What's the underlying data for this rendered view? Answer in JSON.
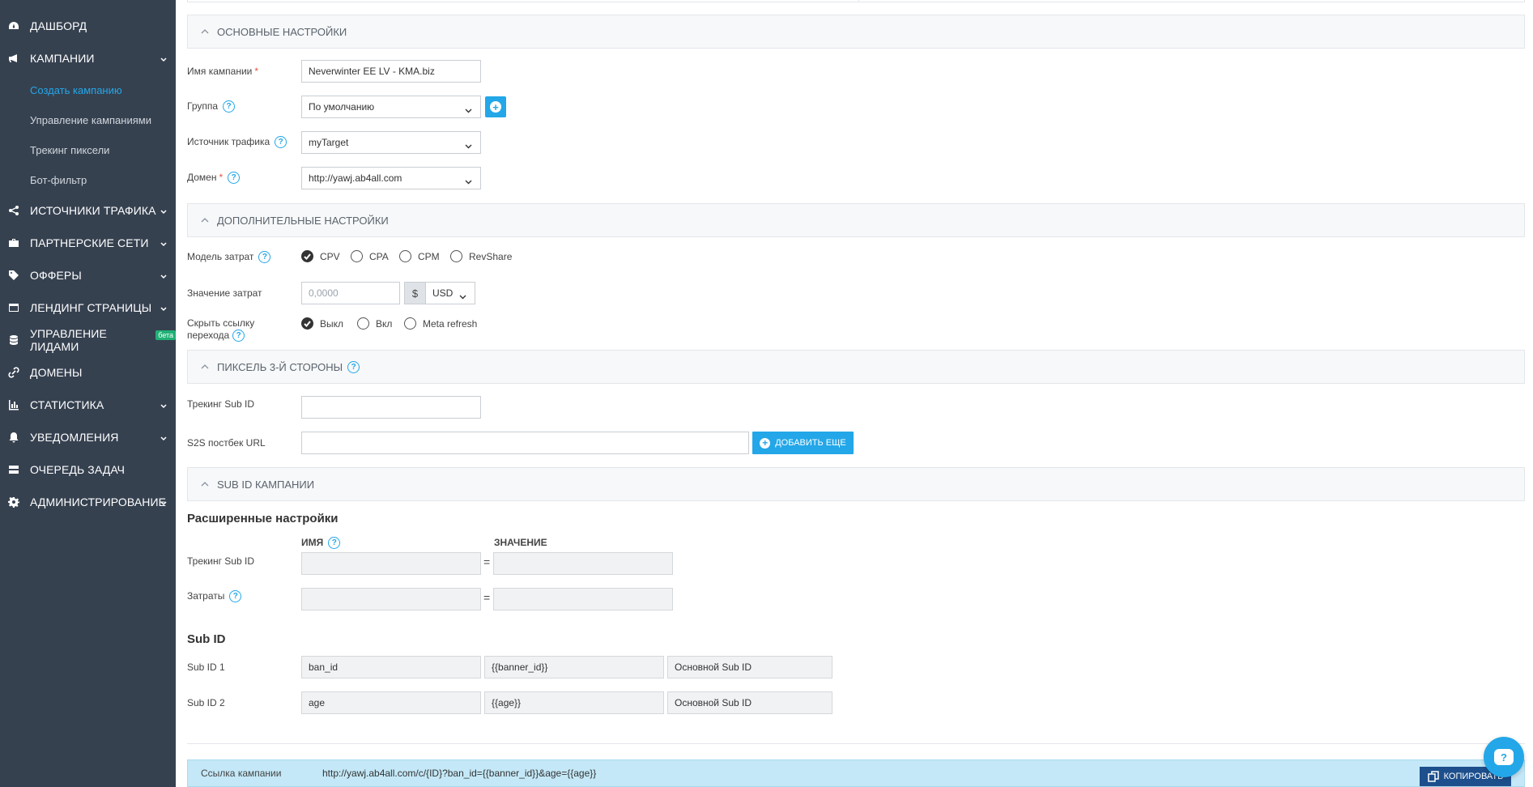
{
  "sidebar": {
    "items": [
      {
        "label": "Дашборд",
        "icon": "dashboard-icon"
      },
      {
        "label": "Кампании",
        "icon": "megaphone-icon"
      },
      {
        "label": "Источники трафика",
        "icon": "share-icon"
      },
      {
        "label": "Партнерские сети",
        "icon": "briefcase-icon"
      },
      {
        "label": "Офферы",
        "icon": "tags-icon"
      },
      {
        "label": "Лендинг страницы",
        "icon": "page-icon"
      },
      {
        "label": "Управление лидами",
        "icon": "database-icon",
        "badge": "бета"
      },
      {
        "label": "Домены",
        "icon": "link-icon"
      },
      {
        "label": "Статистика",
        "icon": "bar-chart-icon"
      },
      {
        "label": "Уведомления",
        "icon": "bell-icon"
      },
      {
        "label": "Очередь задач",
        "icon": "server-icon"
      },
      {
        "label": "Администрирование",
        "icon": "gear-icon"
      }
    ],
    "sub_items": [
      "Создать кампанию",
      "Управление кампаниями",
      "Трекинг пиксели",
      "Бот-фильтр"
    ]
  },
  "sections": {
    "basic": "Основные настройки",
    "additional": "Дополнительные настройки",
    "pixel": "Пиксель 3-й стороны",
    "subid": "Sub ID кампании"
  },
  "basic": {
    "name_label": "Имя кампании",
    "name_value": "Neverwinter EE LV - KMA.biz",
    "group_label": "Группа",
    "group_value": "По умолчанию",
    "source_label": "Источник трафика",
    "source_value": "myTarget",
    "domain_label": "Домен",
    "domain_value": "http://yawj.ab4all.com",
    "required_mark": "*"
  },
  "additional": {
    "cost_model_label": "Модель затрат",
    "cost_models": [
      "CPV",
      "CPA",
      "CPM",
      "RevShare"
    ],
    "cost_value_label": "Значение затрат",
    "cost_value_placeholder": "0,0000",
    "currency_symbol": "$",
    "currency": "USD",
    "hide_link_label_1": "Скрыть ссылку",
    "hide_link_label_2": "перехода",
    "hide_options": [
      "Выкл",
      "Вкл",
      "Meta refresh"
    ]
  },
  "pixel": {
    "tracking_label": "Трекинг Sub ID",
    "s2s_label": "S2S постбек URL",
    "add_more": "Добавить еще"
  },
  "advanced": {
    "title": "Расширенные настройки",
    "col_name": "Имя",
    "col_value": "Значение",
    "rows": [
      "Трекинг Sub ID",
      "Затраты"
    ],
    "eq": "="
  },
  "subid": {
    "title": "Sub ID",
    "rows": [
      {
        "label": "Sub ID 1",
        "name": "ban_id",
        "value": "{{banner_id}}",
        "type": "Основной Sub ID"
      },
      {
        "label": "Sub ID 2",
        "name": "age",
        "value": "{{age}}",
        "type": "Основной Sub ID"
      }
    ]
  },
  "campaign_link": {
    "label": "Ссылка кампании",
    "value": "http://yawj.ab4all.com/c/{ID}?ban_id={{banner_id}}&age={{age}}",
    "copy": "Копировать"
  },
  "help_glyph": "?",
  "chat_glyph": "?"
}
